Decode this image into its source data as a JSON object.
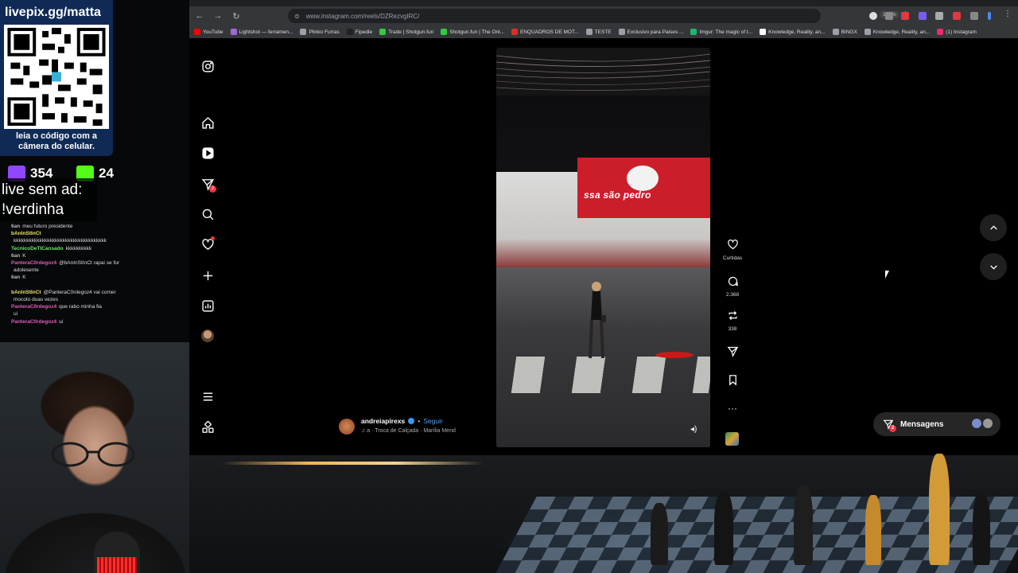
{
  "overlay": {
    "qr_url": "livepix.gg/matta",
    "qr_caption": "leia o código com a câmera do celular.",
    "twitch_count": "354",
    "kick_count": "24",
    "promo_line1": "live sem ad:",
    "promo_line2": "!verdinha",
    "chat": [
      {
        "user": "6an",
        "color": "w",
        "text": "meu futuro presidente"
      },
      {
        "user": "bAnInStInCt",
        "color": "y",
        "text": ""
      },
      {
        "user": "",
        "color": "w",
        "text": "kkkkkkkkkkkkkkkkkkkkkkkkkkkkkkkkkkkk"
      },
      {
        "user": "TecnicoDeTICansado",
        "color": "g",
        "text": "kkkkkkkkkk"
      },
      {
        "user": "6an",
        "color": "w",
        "text": "K"
      },
      {
        "user": "PanteraC0rdegoz4",
        "color": "p",
        "text": "@bAnInStInCt rapai se for"
      },
      {
        "user": "",
        "color": "w",
        "text": "adolesente"
      },
      {
        "user": "6an",
        "color": "w",
        "text": "K"
      },
      {
        "user": "",
        "color": "p",
        "text": ""
      },
      {
        "user": "bAnInStInCt",
        "color": "y",
        "text": "@PanteraC0rdegoz4 vai comer"
      },
      {
        "user": "",
        "color": "w",
        "text": "mocoto duas vezes"
      },
      {
        "user": "PanteraC0rdegoz4",
        "color": "p",
        "text": "que rabo minha fia"
      },
      {
        "user": "",
        "color": "p",
        "text": "ui"
      },
      {
        "user": "PanteraC0rdegoz4",
        "color": "p",
        "text": "ui"
      }
    ]
  },
  "browser": {
    "url": "www.instagram.com/reels/DZRezvgIRC/",
    "zoom": "120%",
    "bookmarks": [
      {
        "label": "YouTube",
        "color": "#ff0000"
      },
      {
        "label": "Lightshot — ferramen...",
        "color": "#9c6ad6"
      },
      {
        "label": "Plinko Furras",
        "color": "#9aa0a6"
      },
      {
        "label": "Fipedle",
        "color": "#222222"
      },
      {
        "label": "Trade | Shotgun.fun",
        "color": "#2ecc40"
      },
      {
        "label": "Shotgun.fun | The Onl...",
        "color": "#2ecc40"
      },
      {
        "label": "ENQUADROS DE MOT...",
        "color": "#d93025"
      },
      {
        "label": "TESTE",
        "color": "#9aa0a6"
      },
      {
        "label": "Exclusivo para Paises ...",
        "color": "#9aa0a6"
      },
      {
        "label": "Imgur: The magic of t...",
        "color": "#1bb76e"
      },
      {
        "label": "Knowledge, Reality, an...",
        "color": "#ffffff"
      },
      {
        "label": "BINGX",
        "color": "#9aa0a6"
      },
      {
        "label": "Knowledge, Reality, an...",
        "color": "#9aa0a6"
      },
      {
        "label": "(1) Instagram",
        "color": "#e1306c"
      }
    ]
  },
  "instagram": {
    "nav_badge": "2",
    "reel": {
      "sign_text": "ssa são pedro",
      "author": "andreiapirexs",
      "follow_label": "Seguir",
      "audio": "a · Troca de Calçada · Marília Mend"
    },
    "actions": {
      "likes_label": "Curtidas",
      "comments": "2.368",
      "reposts": "338"
    },
    "messages_label": "Mensagens",
    "messages_badge": "2"
  }
}
